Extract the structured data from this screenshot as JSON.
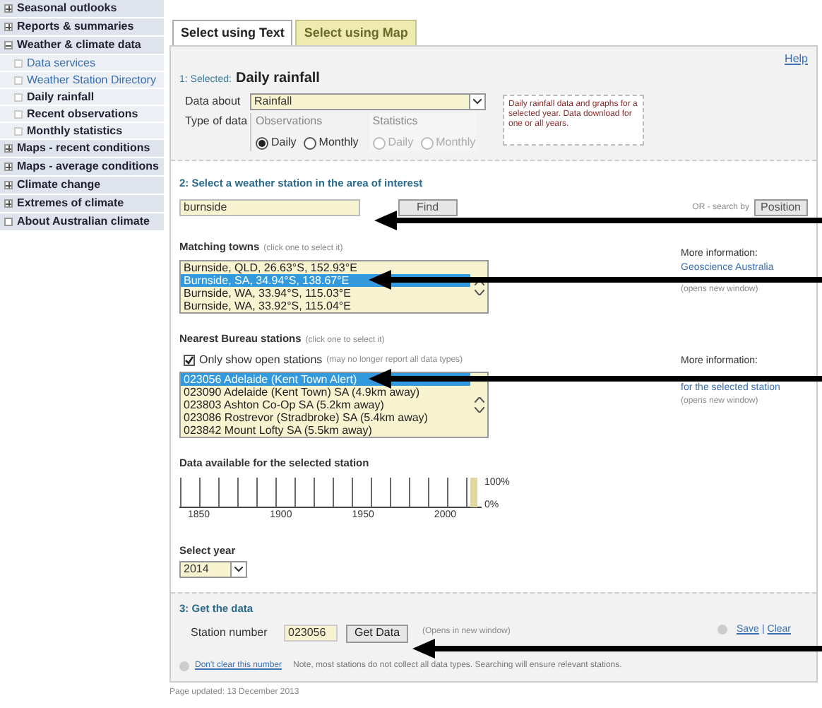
{
  "sidebar": {
    "items": [
      {
        "label": "Seasonal outlooks",
        "expanded": false
      },
      {
        "label": "Reports & summaries",
        "expanded": false
      },
      {
        "label": "Weather & climate data",
        "expanded": true,
        "children": [
          {
            "label": "Data services",
            "kind": "link"
          },
          {
            "label": "Weather Station Directory",
            "kind": "link"
          },
          {
            "label": "Daily rainfall",
            "kind": "page"
          },
          {
            "label": "Recent observations",
            "kind": "page"
          },
          {
            "label": "Monthly statistics",
            "kind": "page"
          }
        ]
      },
      {
        "label": "Maps - recent conditions",
        "expanded": false
      },
      {
        "label": "Maps - average conditions",
        "expanded": false
      },
      {
        "label": "Climate change",
        "expanded": false
      },
      {
        "label": "Extremes of climate",
        "expanded": false
      },
      {
        "label": "About Australian climate",
        "kind": "leaf"
      }
    ]
  },
  "tabs": [
    {
      "label": "Select using Text",
      "selected": true
    },
    {
      "label": "Select using Map",
      "selected": false
    }
  ],
  "help_link": "Help",
  "step1": {
    "prefix": "1: Selected:",
    "title": "Daily rainfall",
    "data_about_label": "Data about",
    "data_about_value": "Rainfall",
    "type_label": "Type of data",
    "groups": [
      {
        "label": "Observations",
        "disabled": false,
        "options": [
          {
            "label": "Daily",
            "selected": true
          },
          {
            "label": "Monthly",
            "selected": false
          }
        ]
      },
      {
        "label": "Statistics",
        "disabled": true,
        "options": [
          {
            "label": "Daily",
            "selected": false
          },
          {
            "label": "Monthly",
            "selected": false
          }
        ]
      }
    ],
    "description": "Daily rainfall data and graphs for a selected year. Data download for one or all years."
  },
  "step2": {
    "title": "2:  Select a weather station in the area of interest",
    "search_value": "burnside",
    "find_button": "Find",
    "or_text": "OR - search by",
    "position_button": "Position",
    "towns_label": "Matching towns",
    "towns_hint": "(click one to select it)",
    "towns": [
      {
        "label": "Burnside, QLD, 26.63°S, 152.93°E",
        "selected": false
      },
      {
        "label": "Burnside, SA, 34.94°S, 138.67°E",
        "selected": true
      },
      {
        "label": "Burnside, WA, 33.94°S, 115.03°E",
        "selected": false
      },
      {
        "label": "Burnside, WA, 33.92°S, 115.04°E",
        "selected": false
      }
    ],
    "towns_info": {
      "label": "More information:",
      "link": "Geoscience Australia",
      "note": "(opens new window)"
    },
    "stations_label": "Nearest Bureau stations",
    "stations_hint": "(click one to select it)",
    "open_only": {
      "label": "Only show open stations",
      "hint": "(may no longer report all data types)",
      "checked": true
    },
    "stations": [
      {
        "label": "023056 Adelaide (Kent Town Alert)",
        "selected": true
      },
      {
        "label": "023090 Adelaide (Kent Town) SA (4.9km away)",
        "selected": false
      },
      {
        "label": "023803 Ashton Co-Op SA (5.2km away)",
        "selected": false
      },
      {
        "label": "023086 Rostrevor (Stradbroke) SA (5.4km away)",
        "selected": false
      },
      {
        "label": "023842 Mount Lofty SA (5.5km away)",
        "selected": false
      }
    ],
    "stations_info": {
      "label": "More information:",
      "link": "for the selected station",
      "note": "(opens new window)"
    },
    "availability_label": "Data available for the selected station",
    "year_labels": [
      "1850",
      "1900",
      "1950",
      "2000"
    ],
    "scale_labels": [
      "100%",
      "0%"
    ],
    "year_label": "Select year",
    "year_value": "2014"
  },
  "step3": {
    "title": "3:  Get the data",
    "station_label": "Station number",
    "station_value": "023056",
    "get_button": "Get Data",
    "opens_note": "(Opens in new window)",
    "save_link": "Save",
    "separator": "|",
    "clear_link": "Clear",
    "dont_clear_link": "Don't clear this number",
    "note": "Note, most stations do not collect all data types. Searching will ensure relevant stations."
  },
  "footer": "Page updated: 13 December 2013"
}
